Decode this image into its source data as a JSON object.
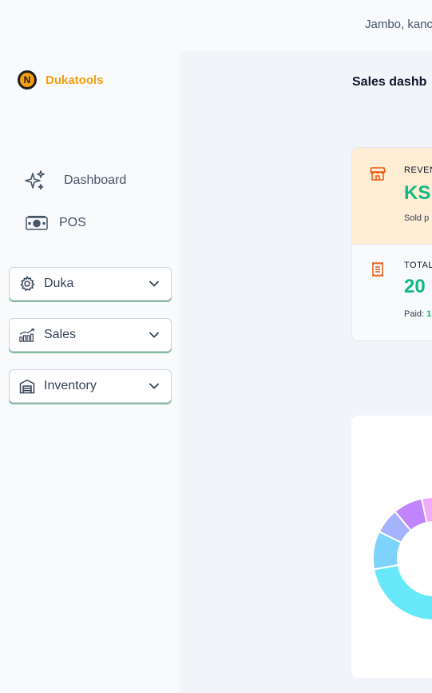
{
  "header": {
    "greeting": "Jambo, kanc"
  },
  "sidebar": {
    "brand": {
      "logo_letter": "N",
      "name": "Dukatools"
    },
    "nav": [
      {
        "label": "Dashboard",
        "icon": "sparkles-icon"
      },
      {
        "label": "POS",
        "icon": "cash-icon"
      }
    ],
    "menus": [
      {
        "label": "Duka",
        "icon": "gear-icon"
      },
      {
        "label": "Sales",
        "icon": "chart-bars-icon"
      },
      {
        "label": "Inventory",
        "icon": "warehouse-icon"
      }
    ]
  },
  "main": {
    "title": "Sales dashb",
    "stats": {
      "revenue": {
        "label": "REVEN",
        "value": "KSI",
        "sub": "Sold p"
      },
      "orders": {
        "label": "TOTAL",
        "value": "20",
        "sub_label": "Paid:",
        "sub_value": "1"
      }
    },
    "accent": "#10b981",
    "brand_color": "#f59e0b"
  },
  "chart_data": {
    "type": "pie",
    "slices": [
      {
        "color": "#fbbf24"
      },
      {
        "color": "#f0abfc"
      },
      {
        "color": "#c084fc"
      },
      {
        "color": "#a5b4fc"
      },
      {
        "color": "#7dd3fc"
      },
      {
        "color": "#67e8f9"
      }
    ]
  }
}
